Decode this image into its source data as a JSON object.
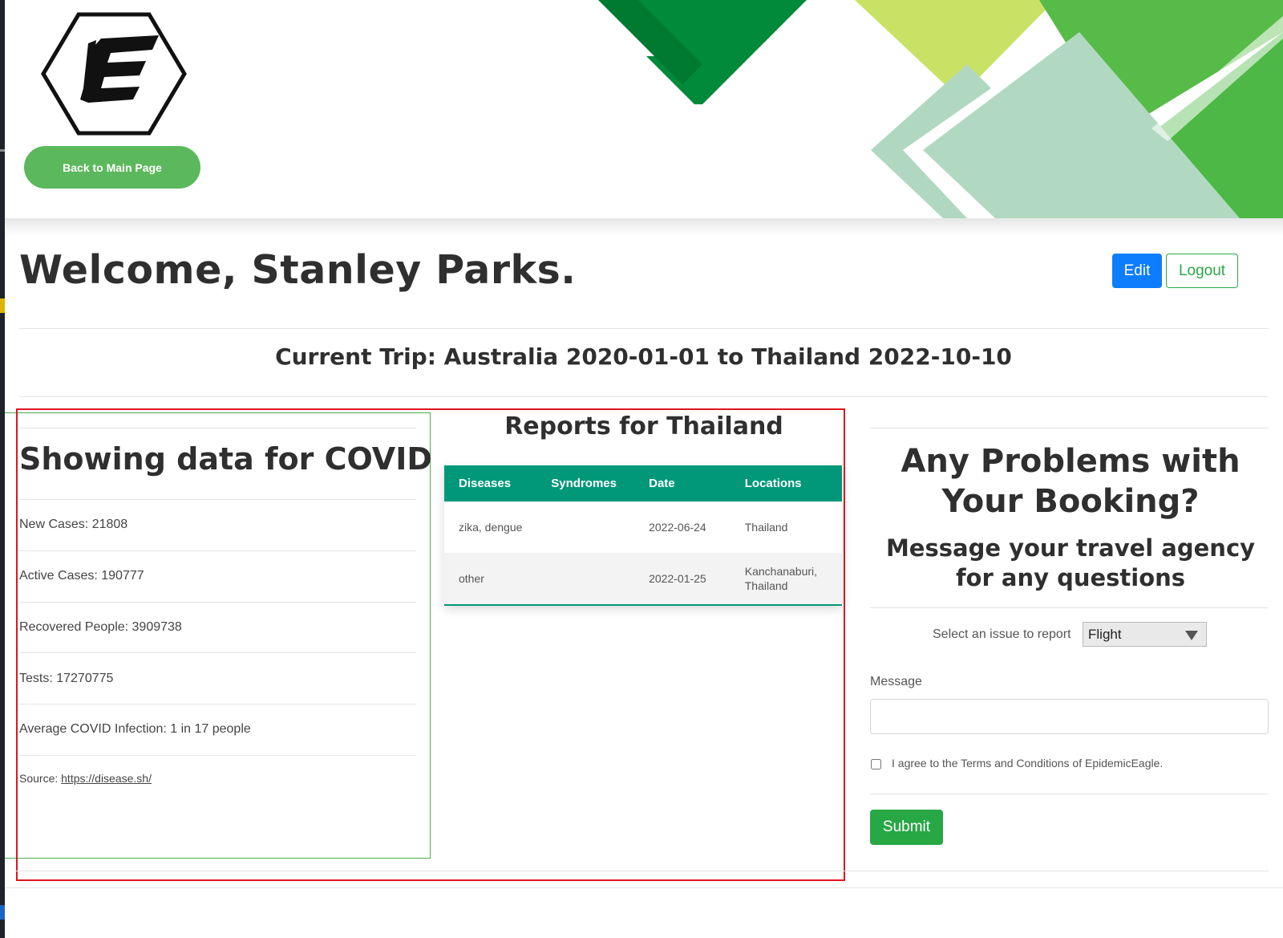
{
  "header": {
    "back_button_label": "Back to Main Page"
  },
  "user": {
    "welcome": "Welcome, Stanley Parks.",
    "edit_label": "Edit",
    "logout_label": "Logout"
  },
  "trip": {
    "text": "Current Trip: Australia 2020-01-01 to Thailand 2022-10-10"
  },
  "covid": {
    "title": "Showing data for COVID",
    "stats": [
      "New Cases: 21808",
      "Active Cases: 190777",
      "Recovered People: 3909738",
      "Tests: 17270775",
      "Average COVID Infection: 1 in 17 people"
    ],
    "source_label": "Source:",
    "source_link": "https://disease.sh/"
  },
  "reports": {
    "title": "Reports for Thailand",
    "columns": [
      "Diseases",
      "Syndromes",
      "Date",
      "Locations"
    ],
    "rows": [
      {
        "diseases": "zika, dengue",
        "syndromes": "",
        "date": "2022-06-24",
        "locations": "Thailand"
      },
      {
        "diseases": "other",
        "syndromes": "",
        "date": "2022-01-25",
        "locations": "Kanchanaburi, Thailand"
      }
    ]
  },
  "support": {
    "title": "Any Problems with Your Booking?",
    "subtitle": "Message your travel agency for any questions",
    "issue_label": "Select an issue to report",
    "issue_selected": "Flight",
    "message_label": "Message",
    "message_value": "",
    "agree_text": "I agree to the Terms and Conditions of EpidemicEagle.",
    "submit_label": "Submit"
  },
  "colors": {
    "primary_green": "#5cb85c",
    "table_header": "#009879",
    "edit_blue": "#0d7dfd",
    "success_green": "#28a745",
    "highlight_red": "#e0141e"
  }
}
